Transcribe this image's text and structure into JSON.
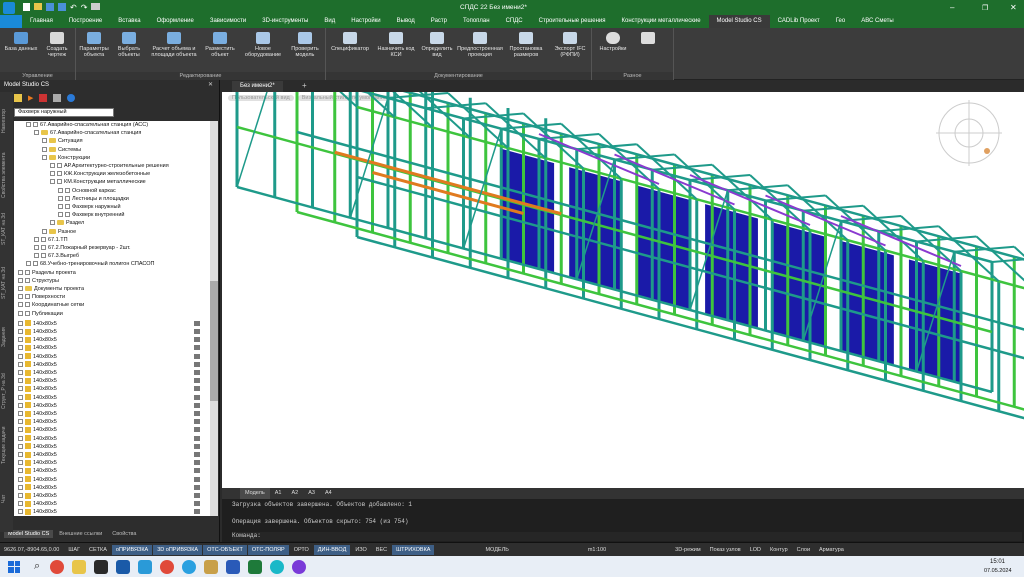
{
  "window": {
    "title": "СПДС 22 Без имени2*"
  },
  "menu": [
    "Главная",
    "Построение",
    "Вставка",
    "Оформление",
    "Зависимости",
    "3D-инструменты",
    "Вид",
    "Настройки",
    "Вывод",
    "Растр",
    "Топоплан",
    "СПДС",
    "Строительные решения",
    "Конструкции металлические",
    "Model Studio CS",
    "CADLib Проект",
    "Гео",
    "АВС Сметы"
  ],
  "menu_active": "Model Studio CS",
  "ribbon": {
    "groups": [
      {
        "label": "Управление",
        "buttons": [
          "База данных",
          "Создать чертеж"
        ]
      },
      {
        "label": "Редактирование",
        "buttons": [
          "Параметры объекта",
          "Выбрать объекты",
          "Расчет объема и площади объекта",
          "Разместить объект",
          "Новое оборудование",
          "Проверить модель"
        ]
      },
      {
        "label": "Документирование",
        "buttons": [
          "Спецификатор",
          "Назначить код КСИ",
          "Определить вид",
          "Предпостроенная проекция",
          "Простановка размеров",
          "Экспорт IFC (РФПИ)"
        ]
      },
      {
        "label": "Разное",
        "buttons": [
          "Настройки"
        ]
      }
    ]
  },
  "panel": {
    "title": "Model Studio CS",
    "filter": "Фахверк наружный",
    "bottom_tabs": [
      "Model Studio CS",
      "Внешние ссылки",
      "Свойства"
    ]
  },
  "side_tabs": [
    "Навигатор",
    "Свойства элемента",
    "ST_КАТ на 3d",
    "ST_КАТ на 3d",
    "Задания",
    "Структ_Р на 3d",
    "Текущие задачи",
    "Чат"
  ],
  "tree": [
    {
      "t": "67.Аварийно-спасательная станция (АСС)",
      "lvl": 1,
      "icon": "node"
    },
    {
      "t": "67.Аварийно-спасательная станция",
      "lvl": 2,
      "icon": "folder"
    },
    {
      "t": "Ситуация",
      "lvl": 3,
      "icon": "folder"
    },
    {
      "t": "Системы",
      "lvl": 3,
      "icon": "folder"
    },
    {
      "t": "Конструкции",
      "lvl": 3,
      "icon": "folder"
    },
    {
      "t": "АР.Архитектурно-строительные решения",
      "lvl": 4,
      "icon": "node"
    },
    {
      "t": "КЖ.Конструкции железобетонные",
      "lvl": 4,
      "icon": "node"
    },
    {
      "t": "КМ.Конструкции металлические",
      "lvl": 4,
      "icon": "node"
    },
    {
      "t": "Основной каркас",
      "lvl": 5,
      "icon": "node"
    },
    {
      "t": "Лестницы и площадки",
      "lvl": 5,
      "icon": "node"
    },
    {
      "t": "Фахверк наружный",
      "lvl": 5,
      "icon": "node"
    },
    {
      "t": "Фахверк внутренний",
      "lvl": 5,
      "icon": "node"
    },
    {
      "t": "Раздел",
      "lvl": 4,
      "icon": "folder"
    },
    {
      "t": "Разное",
      "lvl": 3,
      "icon": "folder"
    },
    {
      "t": "67.1.ТП",
      "lvl": 2,
      "icon": "node"
    },
    {
      "t": "67.2.Пожарный резервуар - 2шт.",
      "lvl": 2,
      "icon": "node"
    },
    {
      "t": "67.3.Выгреб",
      "lvl": 2,
      "icon": "node"
    },
    {
      "t": "68.Учебно-тренировочный полигон СПАСОП",
      "lvl": 1,
      "icon": "node"
    },
    {
      "t": "Разделы проекта",
      "lvl": 0,
      "icon": "node"
    },
    {
      "t": "Структуры",
      "lvl": 0,
      "icon": "node"
    },
    {
      "t": "Документы проекта",
      "lvl": 0,
      "icon": "folder"
    },
    {
      "t": "Поверхности",
      "lvl": 0,
      "icon": "node"
    },
    {
      "t": "Координатные сетки",
      "lvl": 0,
      "icon": "node"
    },
    {
      "t": "Публикации",
      "lvl": 0,
      "icon": "node"
    }
  ],
  "list_item_label": "140x80x5",
  "list_item_count": 24,
  "doc_tab": "Без имени2*",
  "view_labels": [
    "Пользовательский вид",
    "Визуальный стиль: по умолчанию"
  ],
  "layout_tabs": [
    "Модель",
    "A1",
    "A2",
    "A3",
    "A4"
  ],
  "command_lines": [
    "Загрузка объектов завершена. Объектов добавлено: 1",
    "Операция завершена. Объектов скрыто: 754 (из 754)",
    "Команда:"
  ],
  "status": {
    "coords": "9626.07,-8904.65,0.00",
    "buttons": [
      {
        "t": "ШАГ",
        "on": false
      },
      {
        "t": "СЕТКА",
        "on": false
      },
      {
        "t": "оПРИВЯЗКА",
        "on": true
      },
      {
        "t": "3D оПРИВЯЗКА",
        "on": true
      },
      {
        "t": "ОТС-ОБЪЕКТ",
        "on": true
      },
      {
        "t": "ОТС-ПОЛЯР",
        "on": true
      },
      {
        "t": "ОРТО",
        "on": false
      },
      {
        "t": "ДИН-ВВОД",
        "on": true
      },
      {
        "t": "ИЗО",
        "on": false
      },
      {
        "t": "ВЕС",
        "on": false
      },
      {
        "t": "ШТРИХОВКА",
        "on": true
      }
    ],
    "model": "МОДЕЛЬ",
    "scale": "m1:100",
    "right": [
      "3D-режим",
      "Показ узлов",
      "LOD",
      "Контур",
      "Слои",
      "Арматура"
    ]
  },
  "taskbar": {
    "time": "15:01",
    "date": "07.05.2024"
  },
  "colors": {
    "accent": "#1e6e2c",
    "frame_teal": "#1e9a8a",
    "frame_green": "#3ec43e",
    "frame_blue": "#1a1aa8",
    "frame_orange": "#e07a1f",
    "frame_purple": "#8a3ad0"
  }
}
